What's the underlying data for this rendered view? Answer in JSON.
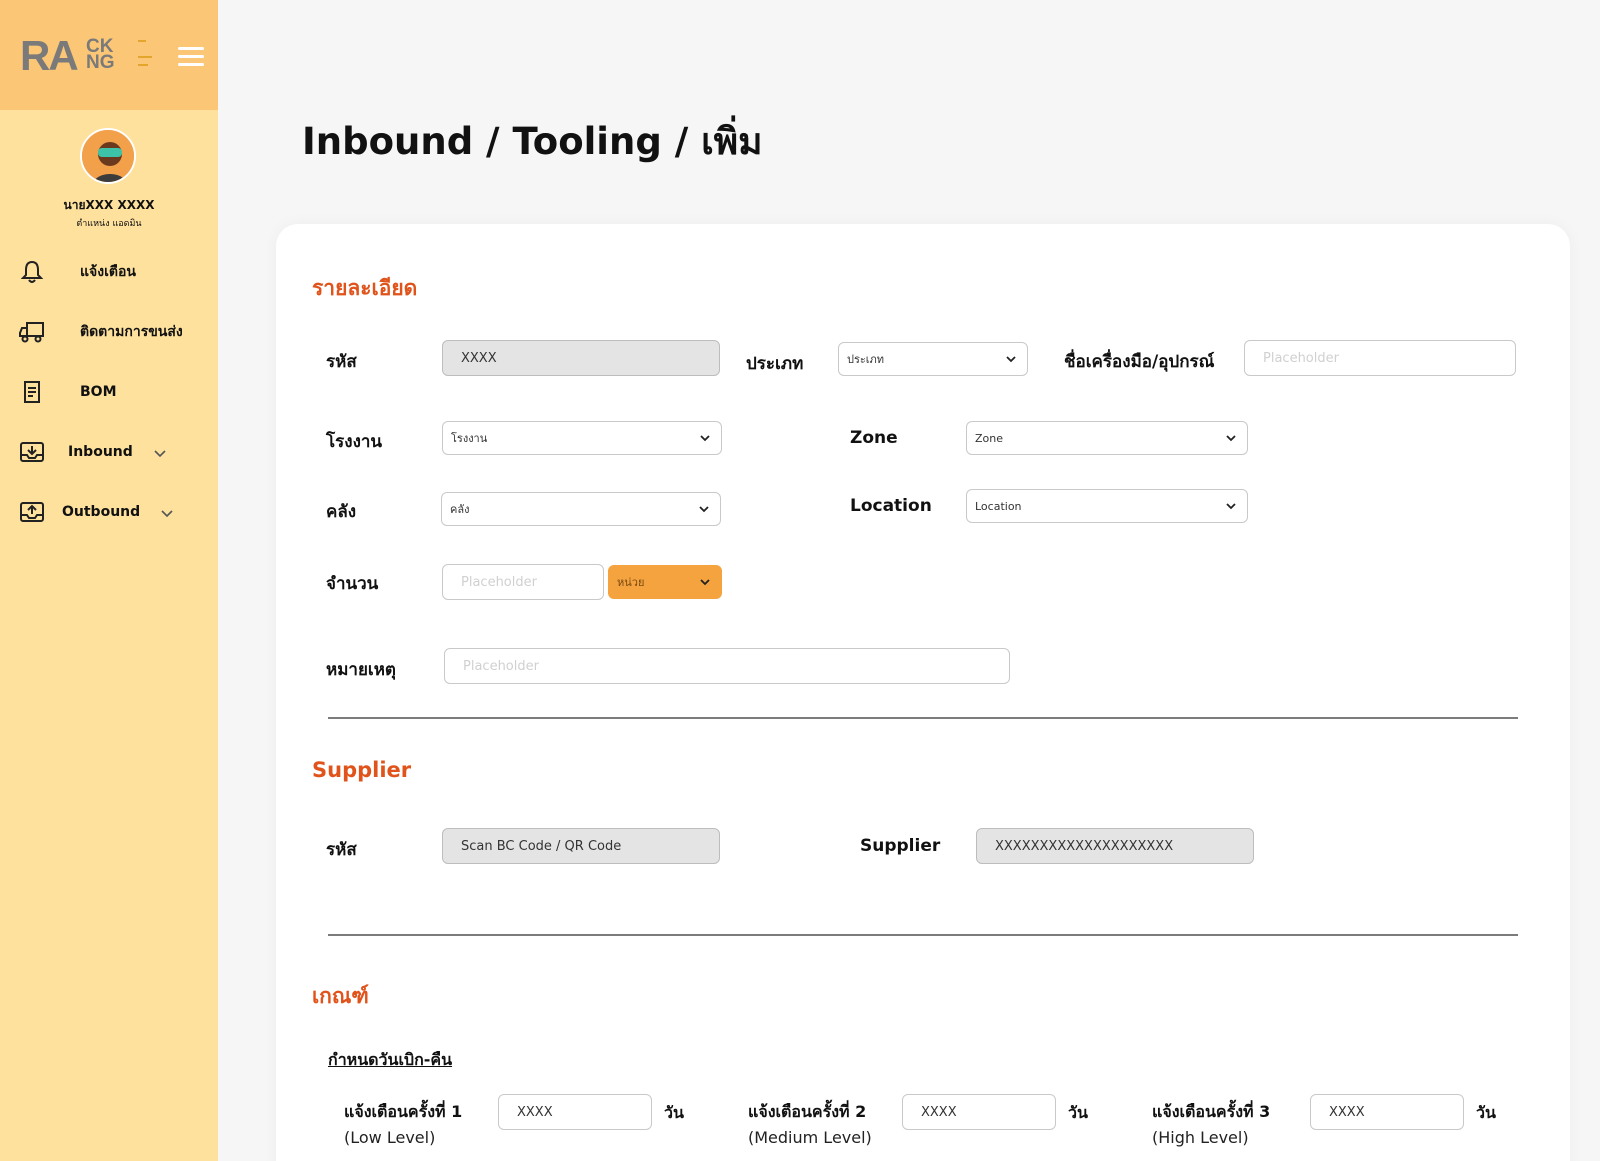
{
  "brand": {
    "logo_main": "RA",
    "logo_top": "CK",
    "logo_bottom": "NG"
  },
  "user": {
    "name": "นายXXX XXXX",
    "role": "ตำแหน่ง แอดมิน"
  },
  "sidebar": {
    "items": [
      {
        "label": "แจ้งเตือน"
      },
      {
        "label": "ติดตามการขนส่ง"
      },
      {
        "label": "BOM"
      },
      {
        "label": "Inbound"
      },
      {
        "label": "Outbound"
      }
    ]
  },
  "page": {
    "title": "Inbound / Tooling / เพิ่ม"
  },
  "details": {
    "title": "รายละเอียด",
    "code_label": "รหัส",
    "code_value": "XXXX",
    "type_label": "ประเภท",
    "type_value": "ประเภท",
    "tool_label": "ชื่อเครื่องมือ/อุปกรณ์",
    "tool_placeholder": "Placeholder",
    "factory_label": "โรงงาน",
    "factory_value": "โรงงาน",
    "zone_label": "Zone",
    "zone_value": "Zone",
    "warehouse_label": "คลัง",
    "warehouse_value": "คลัง",
    "location_label": "Location",
    "location_value": "Location",
    "qty_label": "จำนวน",
    "qty_placeholder": "Placeholder",
    "unit_value": "หน่วย",
    "note_label": "หมายเหตุ",
    "note_placeholder": "Placeholder"
  },
  "supplier": {
    "title": "Supplier",
    "code_label": "รหัส",
    "code_value": "Scan BC Code / QR Code",
    "name_label": "Supplier",
    "name_value": "XXXXXXXXXXXXXXXXXXXX"
  },
  "criteria": {
    "title": "เกณฑ์",
    "subtitle": "กำหนดวันเบิก-คืน",
    "unit": "วัน",
    "alerts": [
      {
        "label": "แจ้งเตือนครั้งที่ 1",
        "level": "(Low Level)",
        "value": "XXXX"
      },
      {
        "label": "แจ้งเตือนครั้งที่ 2",
        "level": "(Medium Level)",
        "value": "XXXX"
      },
      {
        "label": "แจ้งเตือนครั้งที่ 3",
        "level": "(High Level)",
        "value": "XXXX"
      }
    ]
  },
  "colors": {
    "accent": "#e0541c",
    "sidebar_bg": "#fde19d",
    "sidebar_head": "#fbc675",
    "unit_select": "#f4a33e"
  }
}
